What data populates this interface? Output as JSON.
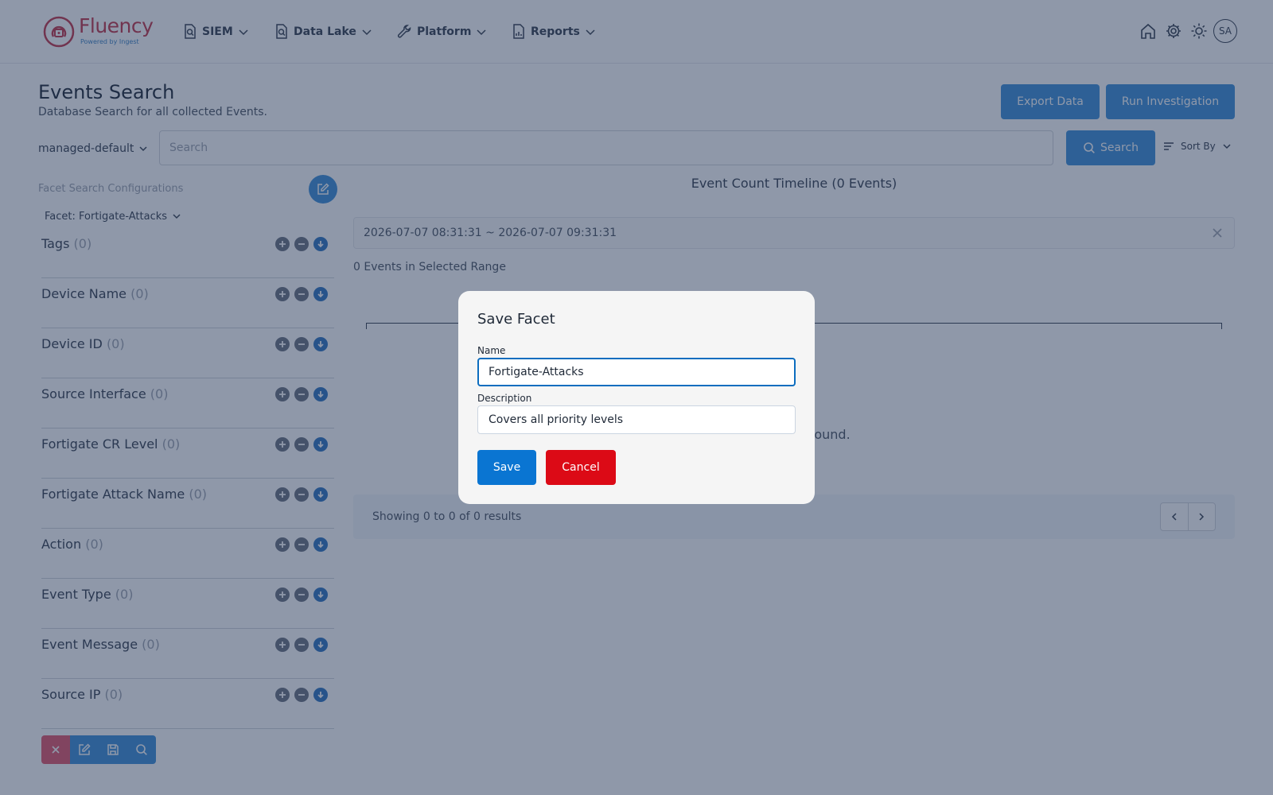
{
  "brand": {
    "name": "Fluency",
    "tagline": "Powered by Ingest"
  },
  "nav": {
    "items": [
      {
        "label": "SIEM",
        "icon": "search-document-icon"
      },
      {
        "label": "Data Lake",
        "icon": "search-document-icon"
      },
      {
        "label": "Platform",
        "icon": "wrench-icon"
      },
      {
        "label": "Reports",
        "icon": "report-icon"
      }
    ],
    "right_icons": [
      "home-icon",
      "gear-icon",
      "sun-icon"
    ],
    "avatar_initials": "SA"
  },
  "page": {
    "title": "Events Search",
    "subtitle": "Database Search for all collected Events.",
    "export_label": "Export Data",
    "run_label": "Run Investigation"
  },
  "search": {
    "namespace": "managed-default",
    "placeholder": "Search",
    "button_label": "Search",
    "sort_label": "Sort By"
  },
  "facets": {
    "config_label": "Facet Search Configurations",
    "selected": "Facet: Fortigate-Attacks",
    "items": [
      {
        "label": "Tags",
        "count": "(0)"
      },
      {
        "label": "Device Name",
        "count": "(0)"
      },
      {
        "label": "Device ID",
        "count": "(0)"
      },
      {
        "label": "Source Interface",
        "count": "(0)"
      },
      {
        "label": "Fortigate CR Level",
        "count": "(0)"
      },
      {
        "label": "Fortigate Attack Name",
        "count": "(0)"
      },
      {
        "label": "Action",
        "count": "(0)"
      },
      {
        "label": "Event Type",
        "count": "(0)"
      },
      {
        "label": "Event Message",
        "count": "(0)"
      },
      {
        "label": "Source IP",
        "count": "(0)"
      }
    ]
  },
  "timeline": {
    "title": "Event Count Timeline (0 Events)",
    "range": "2026-07-07 08:31:31 ~ 2026-07-07 09:31:31",
    "events_in_range": "0 Events in Selected Range",
    "no_data_partial": "ound."
  },
  "results": {
    "summary": "Showing 0 to 0 of 0 results"
  },
  "modal": {
    "title": "Save Facet",
    "name_label": "Name",
    "name_value": "Fortigate-Attacks",
    "description_label": "Description",
    "description_value": "Covers all priority levels",
    "save_label": "Save",
    "cancel_label": "Cancel"
  },
  "colors": {
    "primary": "#3c8fd9",
    "save": "#0a75d2",
    "cancel": "#dc0a16",
    "brand": "#c2374a"
  }
}
